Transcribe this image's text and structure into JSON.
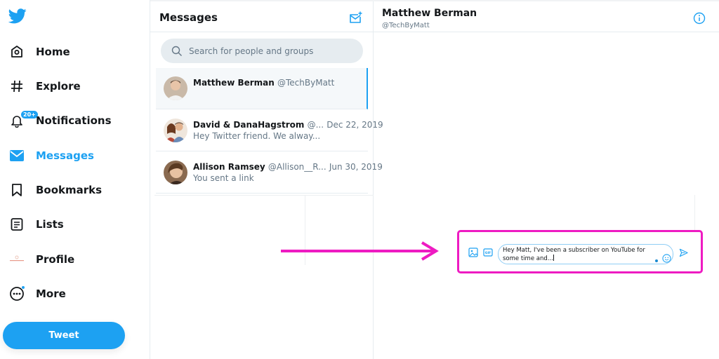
{
  "sidebar": {
    "logo": "twitter-bird-icon",
    "items": [
      {
        "label": "Home",
        "icon": "home-icon"
      },
      {
        "label": "Explore",
        "icon": "hashtag-icon"
      },
      {
        "label": "Notifications",
        "icon": "bell-icon",
        "badge": "20+"
      },
      {
        "label": "Messages",
        "icon": "envelope-icon",
        "active": true
      },
      {
        "label": "Bookmarks",
        "icon": "bookmark-icon"
      },
      {
        "label": "Lists",
        "icon": "list-icon"
      },
      {
        "label": "Profile",
        "icon": "profile-avatar-icon"
      },
      {
        "label": "More",
        "icon": "more-icon"
      }
    ],
    "tweet_button": "Tweet"
  },
  "messages": {
    "title": "Messages",
    "compose_icon": "new-message-icon",
    "search_placeholder": "Search for people and groups",
    "conversations": [
      {
        "name": "Matthew Berman",
        "handle": "@TechByMatt",
        "date": "",
        "preview": "",
        "active": true
      },
      {
        "name": "David & DanaHagstrom",
        "handle": "@...",
        "date": "Dec 22, 2019",
        "preview": "Hey Twitter friend. We alway..."
      },
      {
        "name": "Allison Ramsey",
        "handle": "@Allison__R...",
        "date": "Jun 30, 2019",
        "preview": "You sent a link"
      }
    ]
  },
  "chat": {
    "name": "Matthew Berman",
    "handle": "@TechByMatt",
    "info_icon": "info-icon",
    "composer": {
      "text": "Hey Matt, I've been a subscriber on YouTube for some time and...",
      "media_icon": "image-icon",
      "gif_icon": "gif-icon",
      "emoji_icon": "emoji-icon",
      "send_icon": "send-icon"
    }
  },
  "annotation": {
    "color": "#ee1bc2",
    "arrow": "arrow-right"
  },
  "colors": {
    "accent": "#1da1f2",
    "text": "#14171a",
    "secondary": "#657786"
  }
}
